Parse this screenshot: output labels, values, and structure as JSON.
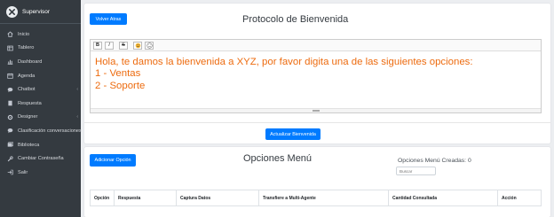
{
  "sidebar": {
    "brand": "Supervisor",
    "items": [
      {
        "label": "Inicio",
        "icon": "home-icon"
      },
      {
        "label": "Tablero",
        "icon": "table-icon"
      },
      {
        "label": "Dashboard",
        "icon": "chart-icon"
      },
      {
        "label": "Agenda",
        "icon": "calendar-icon"
      },
      {
        "label": "Chatbot",
        "icon": "chat-icon"
      },
      {
        "label": "Respuesta",
        "icon": "book-icon"
      },
      {
        "label": "Designer",
        "icon": "cog-icon"
      },
      {
        "label": "Clasificación conversaciones",
        "icon": "chat-icon"
      },
      {
        "label": "Biblioteca",
        "icon": "library-icon"
      },
      {
        "label": "Cambiar Contraseña",
        "icon": "wrench-icon"
      },
      {
        "label": "Salir",
        "icon": "exit-icon"
      }
    ]
  },
  "welcome": {
    "back_button": "Volver Atras",
    "title": "Protocolo de Bienvenida",
    "toolbar": [
      "B",
      "I",
      "S"
    ],
    "message_lines": [
      "Hola, te damos la bienvenida a XYZ, por favor digita una de las siguientes opciones:",
      "1 - Ventas",
      "2 - Soporte"
    ],
    "update_button": "Actualizar Bienvenida"
  },
  "menu": {
    "add_button": "Adicionar Opción",
    "title": "Opciones Menú",
    "count_label": "Opciones Menú Creadas: 0",
    "search_placeholder": "Buscar",
    "columns": [
      "Opción",
      "Respuesta",
      "Captura Datos",
      "Transfiere a Multi-Agente",
      "Cantidad Consultada",
      "Acción"
    ]
  },
  "colors": {
    "sidebar_bg": "#343a40",
    "primary": "#007bff",
    "message_text": "#ed6b0f"
  }
}
